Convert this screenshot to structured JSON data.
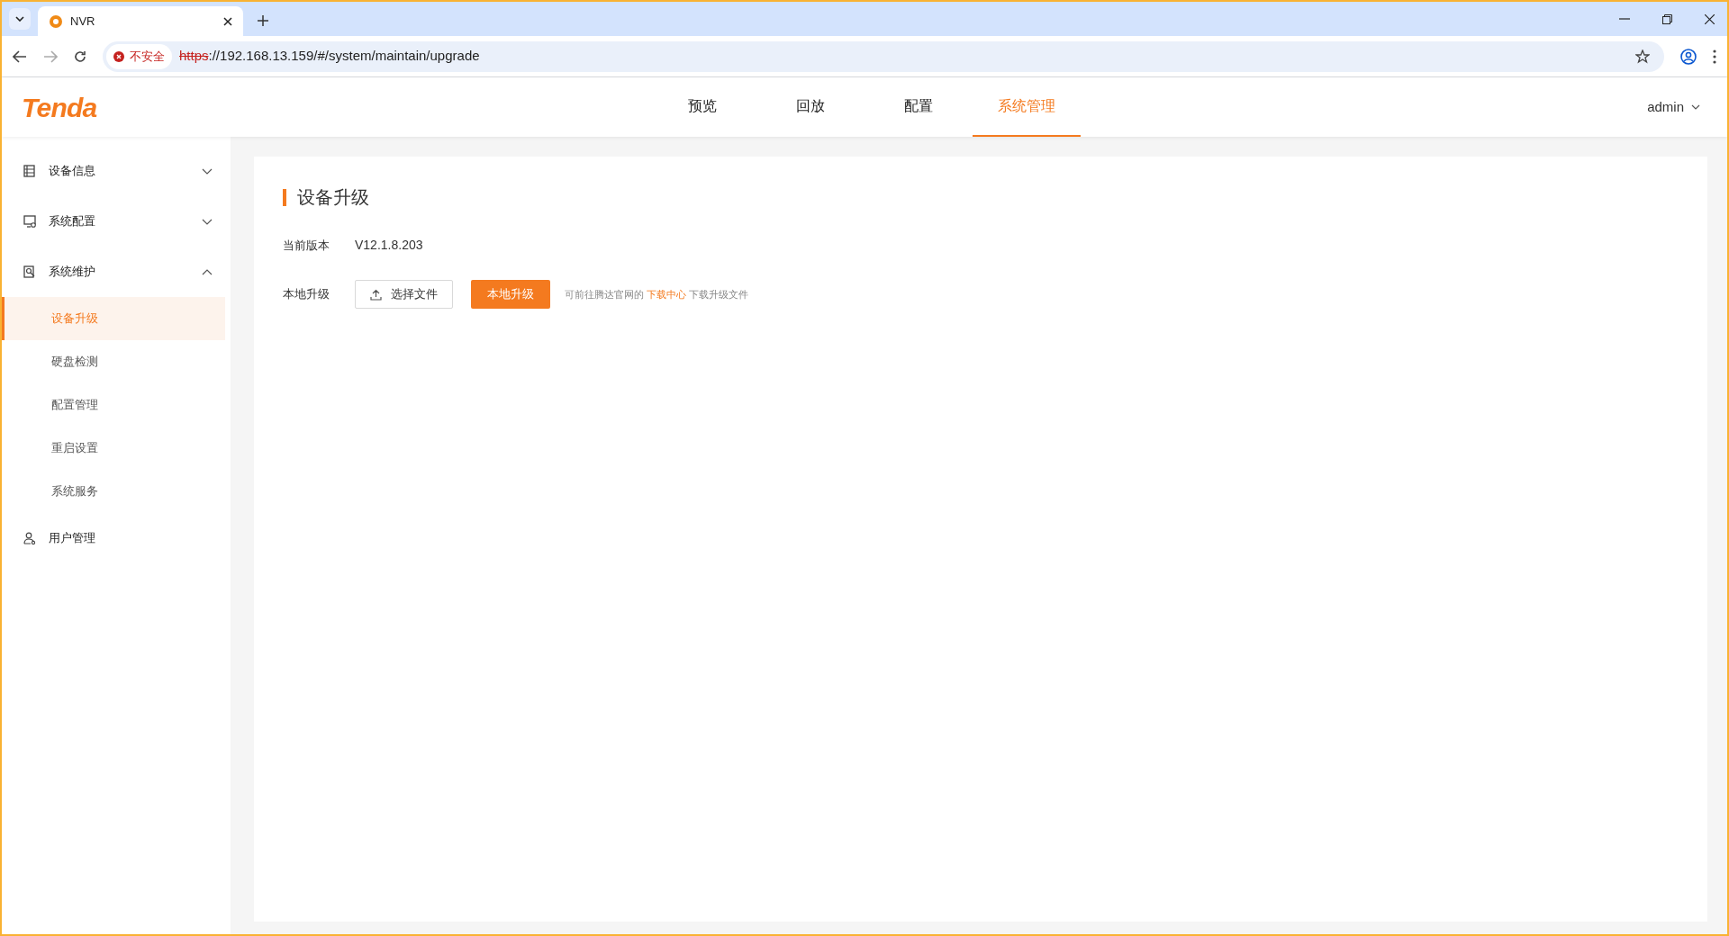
{
  "browser": {
    "tab_title": "NVR",
    "security_label": "不安全",
    "url_scheme": "https",
    "url_rest": "://192.168.13.159/#/system/maintain/upgrade"
  },
  "header": {
    "logo": "Tenda",
    "nav": [
      {
        "label": "预览",
        "selected": false
      },
      {
        "label": "回放",
        "selected": false
      },
      {
        "label": "配置",
        "selected": false
      },
      {
        "label": "系统管理",
        "selected": true
      }
    ],
    "user": "admin"
  },
  "sidebar": {
    "items": [
      {
        "label": "设备信息",
        "expanded": false
      },
      {
        "label": "系统配置",
        "expanded": false
      },
      {
        "label": "系统维护",
        "expanded": true,
        "children": [
          {
            "label": "设备升级",
            "selected": true
          },
          {
            "label": "硬盘检测",
            "selected": false
          },
          {
            "label": "配置管理",
            "selected": false
          },
          {
            "label": "重启设置",
            "selected": false
          },
          {
            "label": "系统服务",
            "selected": false
          }
        ]
      },
      {
        "label": "用户管理"
      }
    ]
  },
  "content": {
    "title": "设备升级",
    "version_label": "当前版本",
    "version_value": "V12.1.8.203",
    "upgrade_label": "本地升级",
    "choose_file_button": "选择文件",
    "upgrade_button": "本地升级",
    "hint_before": "可前往腾达官网的",
    "hint_link": "下载中心",
    "hint_after": "下载升级文件"
  }
}
